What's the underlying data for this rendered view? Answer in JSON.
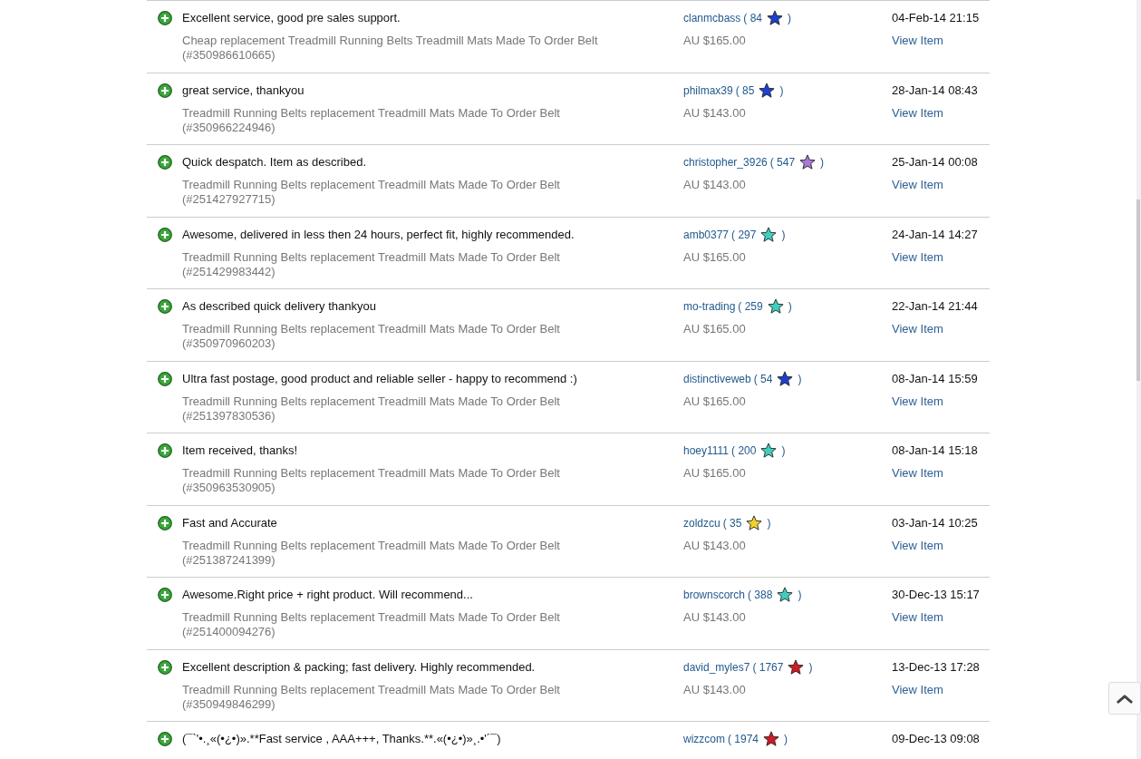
{
  "feedback": [
    {
      "comment": "Excellent service, good pre sales support.",
      "item": "Cheap replacement Treadmill Running Belts Treadmill Mats Made To Order Belt",
      "item_number": "(#350986610665)",
      "user": "clanmcbass",
      "score": "( 84",
      "score_close": ")",
      "color": "#1f3fd0",
      "price": "AU $165.00",
      "date": "04-Feb-14 21:15",
      "link": "View Item"
    },
    {
      "comment": "great service, thankyou",
      "item": "Treadmill Running Belts replacement Treadmill Mats Made To Order Belt",
      "item_number": "(#350966224946)",
      "user": "philmax39",
      "score": "( 85",
      "score_close": ")",
      "color": "#1f3fd0",
      "price": "AU $143.00",
      "date": "28-Jan-14 08:43",
      "link": "View Item"
    },
    {
      "comment": "Quick despatch. Item as described.",
      "item": "Treadmill Running Belts replacement Treadmill Mats Made To Order Belt",
      "item_number": "(#251427927715)",
      "user": "christopher_3926",
      "score": "( 547",
      "score_close": ")",
      "color": "#a77ad6",
      "price": "AU $143.00",
      "date": "25-Jan-14 00:08",
      "link": "View Item"
    },
    {
      "comment": "Awesome, delivered in less then 24 hours, perfect fit, highly recommended.",
      "item": "Treadmill Running Belts replacement Treadmill Mats Made To Order Belt",
      "item_number": "(#251429983442)",
      "user": "amb0377",
      "score": "( 297",
      "score_close": ")",
      "color": "#3fcfbf",
      "price": "AU $165.00",
      "date": "24-Jan-14 14:27",
      "link": "View Item"
    },
    {
      "comment": "As described quick delivery thankyou",
      "item": "Treadmill Running Belts replacement Treadmill Mats Made To Order Belt",
      "item_number": "(#350970960203)",
      "user": "mo-trading",
      "score": "( 259",
      "score_close": ")",
      "color": "#3fcfbf",
      "price": "AU $165.00",
      "date": "22-Jan-14 21:44",
      "link": "View Item"
    },
    {
      "comment": "Ultra fast postage, good product and reliable seller - happy to recommend :)",
      "item": "Treadmill Running Belts replacement Treadmill Mats Made To Order Belt",
      "item_number": "(#251397830536)",
      "user": "distinctiveweb",
      "score": "( 54",
      "score_close": ")",
      "color": "#1f3fd0",
      "price": "AU $165.00",
      "date": "08-Jan-14 15:59",
      "link": "View Item"
    },
    {
      "comment": "Item received, thanks!",
      "item": "Treadmill Running Belts replacement Treadmill Mats Made To Order Belt",
      "item_number": "(#350963530905)",
      "user": "hoey1111",
      "score": "( 200",
      "score_close": ")",
      "color": "#3fcfbf",
      "price": "AU $165.00",
      "date": "08-Jan-14 15:18",
      "link": "View Item"
    },
    {
      "comment": "Fast and Accurate",
      "item": "Treadmill Running Belts replacement Treadmill Mats Made To Order Belt",
      "item_number": "(#251387241399)",
      "user": "zoldzcu",
      "score": "( 35",
      "score_close": ")",
      "color": "#f2d22a",
      "price": "AU $143.00",
      "date": "03-Jan-14 10:25",
      "link": "View Item"
    },
    {
      "comment": "Awesome.Right price + right product. Will recommend...",
      "item": "Treadmill Running Belts replacement Treadmill Mats Made To Order Belt",
      "item_number": "(#251400094276)",
      "user": "brownscorch",
      "score": "( 388",
      "score_close": ")",
      "color": "#3fcfbf",
      "price": "AU $143.00",
      "date": "30-Dec-13 15:17",
      "link": "View Item"
    },
    {
      "comment": "Excellent description & packing; fast delivery. Highly recommended.",
      "item": "Treadmill Running Belts replacement Treadmill Mats Made To Order Belt",
      "item_number": "(#350949846299)",
      "user": "david_myles7",
      "score": "( 1767",
      "score_close": ")",
      "color": "#d01a24",
      "price": "AU $143.00",
      "date": "13-Dec-13 17:28",
      "link": "View Item"
    },
    {
      "comment": "(¯`'•.¸«(•¿•)».**Fast service , AAA+++, Thanks.**.«(•¿•)»¸.•'´¯)",
      "user": "wizzcom",
      "score": "( 1974",
      "score_close": ")",
      "color": "#d01a24",
      "date": "09-Dec-13 09:08"
    }
  ]
}
